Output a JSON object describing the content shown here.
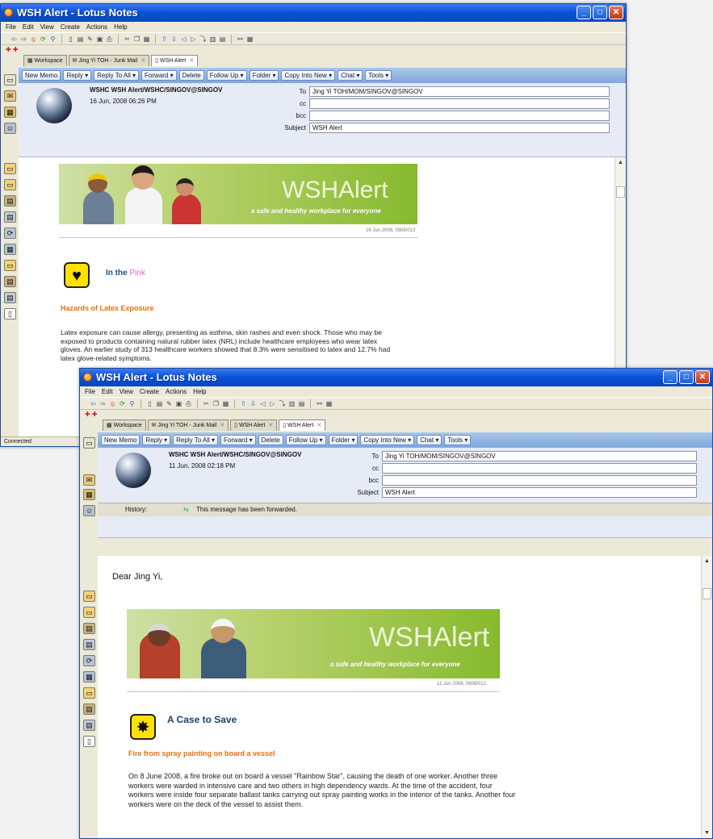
{
  "window1": {
    "title": "WSH Alert - Lotus Notes",
    "menu": [
      "File",
      "Edit",
      "View",
      "Create",
      "Actions",
      "Help"
    ],
    "tabs": [
      "Workspace",
      "Jing Yi TOH - Junk Mail",
      "WSH Alert"
    ],
    "actions": [
      "New Memo",
      "Reply ▾",
      "Reply To All ▾",
      "Forward ▾",
      "Delete",
      "Follow Up ▾",
      "Folder ▾",
      "Copy Into New ▾",
      "Chat ▾",
      "Tools ▾"
    ],
    "from": "WSHC WSH Alert/WSHC/SINGOV@SINGOV",
    "date": "16 Jun, 2008 06:26 PM",
    "to_label": "To",
    "to": "Jing Yi TOH/MOM/SINGOV@SINGOV",
    "cc_label": "cc",
    "bcc_label": "bcc",
    "subject_label": "Subject",
    "subject": "WSH Alert",
    "banner_word": "WSH",
    "banner_word2": "Alert",
    "banner_slogan": "a safe and healthy workplace for everyone",
    "dateline": "16 Jun 2008, 0808/013",
    "section_title": "In the",
    "section_title_pink": "Pink",
    "section_sub": "Hazards of Latex Exposure",
    "body": "Latex exposure can cause allergy, presenting as asthma, skin rashes and even shock. Those who may be exposed to products containing natural rubber latex (NRL) include healthcare employees who wear latex gloves. An earlier study of 313 healthcare workers showed that 8.3% were sensitised to latex and 12.7% had latex glove-related symptoms.",
    "status": "Connected"
  },
  "window2": {
    "title": "WSH Alert - Lotus Notes",
    "menu": [
      "File",
      "Edit",
      "View",
      "Create",
      "Actions",
      "Help"
    ],
    "tabs": [
      "Workspace",
      "Jing Yi TOH - Junk Mail",
      "WSH Alert",
      "WSH Alert"
    ],
    "actions": [
      "New Memo",
      "Reply ▾",
      "Reply To All ▾",
      "Forward ▾",
      "Delete",
      "Follow Up ▾",
      "Folder ▾",
      "Copy Into New ▾",
      "Chat ▾",
      "Tools ▾"
    ],
    "from": "WSHC WSH Alert/WSHC/SINGOV@SINGOV",
    "date": "11 Jun, 2008 02:18 PM",
    "to_label": "To",
    "to": "Jing Yi TOH/MOM/SINGOV@SINGOV",
    "cc_label": "cc",
    "bcc_label": "bcc",
    "subject_label": "Subject",
    "subject": "WSH Alert",
    "history_label": "History:",
    "history_text": "This message has been forwarded.",
    "greeting": "Dear Jing Yi,",
    "banner_word": "WSH",
    "banner_word2": "Alert",
    "banner_slogan": "a safe and healthy workplace for everyone",
    "dateline": "11 Jun 2008, 0808/012",
    "section_title": "A Case to Save",
    "section_sub": "Fire from spray painting on board a vessel",
    "body": "On 8 June 2008, a fire broke out on board a vessel \"Rainbow Star\", causing the death of one worker. Another three workers were warded in intensive care and two others in high dependency wards. At the time of the accident, four workers were inside four separate ballast tanks carrying out spray painting works in the interior of the tanks. Another four workers were on the deck of the vessel to assist them."
  }
}
